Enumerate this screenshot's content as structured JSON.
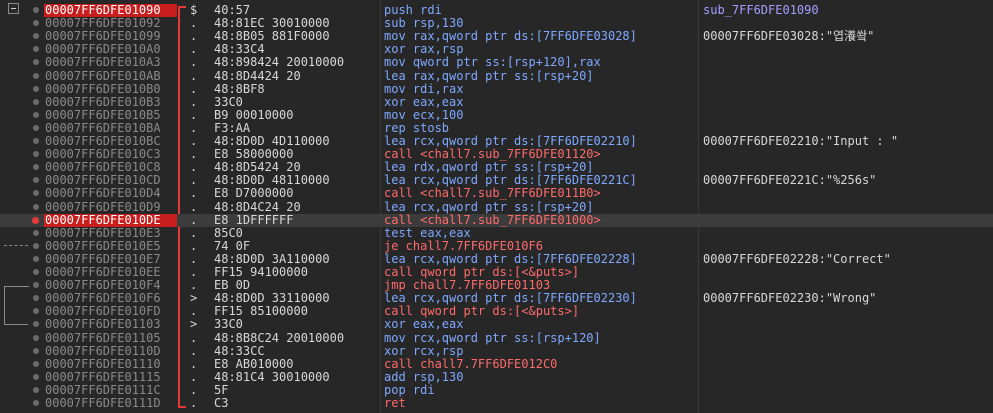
{
  "rows": [
    {
      "addr": "00007FF6DFE01090",
      "mark": "$",
      "bytes": "40:57",
      "instr": "push rdi",
      "comment": "sub_7FF6DFE01090",
      "kind": "",
      "comment_kind": "label",
      "bp": false,
      "current": true
    },
    {
      "addr": "00007FF6DFE01092",
      "mark": ".",
      "bytes": "48:81EC 30010000",
      "instr": "sub rsp,130",
      "comment": "",
      "kind": "",
      "bp": false
    },
    {
      "addr": "00007FF6DFE01099",
      "mark": ".",
      "bytes": "48:8B05 881F0000",
      "instr": "mov rax,qword ptr ds:[7FF6DFE03028]",
      "comment": "00007FF6DFE03028:\"엽瀁쐌\"",
      "kind": "",
      "bp": false
    },
    {
      "addr": "00007FF6DFE010A0",
      "mark": ".",
      "bytes": "48:33C4",
      "instr": "xor rax,rsp",
      "comment": "",
      "kind": "",
      "bp": false
    },
    {
      "addr": "00007FF6DFE010A3",
      "mark": ".",
      "bytes": "48:898424 20010000",
      "instr": "mov qword ptr ss:[rsp+120],rax",
      "comment": "",
      "kind": "",
      "bp": false
    },
    {
      "addr": "00007FF6DFE010AB",
      "mark": ".",
      "bytes": "48:8D4424 20",
      "instr": "lea rax,qword ptr ss:[rsp+20]",
      "comment": "",
      "kind": "",
      "bp": false
    },
    {
      "addr": "00007FF6DFE010B0",
      "mark": ".",
      "bytes": "48:8BF8",
      "instr": "mov rdi,rax",
      "comment": "",
      "kind": "",
      "bp": false
    },
    {
      "addr": "00007FF6DFE010B3",
      "mark": ".",
      "bytes": "33C0",
      "instr": "xor eax,eax",
      "comment": "",
      "kind": "",
      "bp": false
    },
    {
      "addr": "00007FF6DFE010B5",
      "mark": ".",
      "bytes": "B9 00010000",
      "instr": "mov ecx,100",
      "comment": "",
      "kind": "",
      "bp": false
    },
    {
      "addr": "00007FF6DFE010BA",
      "mark": ".",
      "bytes": "F3:AA",
      "instr": "rep stosb",
      "comment": "",
      "kind": "",
      "bp": false
    },
    {
      "addr": "00007FF6DFE010BC",
      "mark": ".",
      "bytes": "48:8D0D 4D110000",
      "instr": "lea rcx,qword ptr ds:[7FF6DFE02210]",
      "comment": "00007FF6DFE02210:\"Input : \"",
      "kind": "",
      "bp": false
    },
    {
      "addr": "00007FF6DFE010C3",
      "mark": ".",
      "bytes": "E8 58000000",
      "instr": "call <chall7.sub_7FF6DFE01120>",
      "comment": "",
      "kind": "call",
      "bp": false
    },
    {
      "addr": "00007FF6DFE010C8",
      "mark": ".",
      "bytes": "48:8D5424 20",
      "instr": "lea rdx,qword ptr ss:[rsp+20]",
      "comment": "",
      "kind": "",
      "bp": false
    },
    {
      "addr": "00007FF6DFE010CD",
      "mark": ".",
      "bytes": "48:8D0D 48110000",
      "instr": "lea rcx,qword ptr ds:[7FF6DFE0221C]",
      "comment": "00007FF6DFE0221C:\"%256s\"",
      "kind": "",
      "bp": false
    },
    {
      "addr": "00007FF6DFE010D4",
      "mark": ".",
      "bytes": "E8 D7000000",
      "instr": "call <chall7.sub_7FF6DFE011B0>",
      "comment": "",
      "kind": "call",
      "bp": false
    },
    {
      "addr": "00007FF6DFE010D9",
      "mark": ".",
      "bytes": "48:8D4C24 20",
      "instr": "lea rcx,qword ptr ss:[rsp+20]",
      "comment": "",
      "kind": "",
      "bp": false
    },
    {
      "addr": "00007FF6DFE010DE",
      "mark": ".",
      "bytes": "E8 1DFFFFFF",
      "instr": "call <chall7.sub_7FF6DFE01000>",
      "comment": "",
      "kind": "call",
      "bp": true,
      "selected": true
    },
    {
      "addr": "00007FF6DFE010E3",
      "mark": ".",
      "bytes": "85C0",
      "instr": "test eax,eax",
      "comment": "",
      "kind": "",
      "bp": false
    },
    {
      "addr": "00007FF6DFE010E5",
      "mark": ".",
      "bytes": "74 0F",
      "instr": "je chall7.7FF6DFE010F6",
      "comment": "",
      "kind": "jmp",
      "bp": false
    },
    {
      "addr": "00007FF6DFE010E7",
      "mark": ".",
      "bytes": "48:8D0D 3A110000",
      "instr": "lea rcx,qword ptr ds:[7FF6DFE02228]",
      "comment": "00007FF6DFE02228:\"Correct\"",
      "kind": "",
      "bp": false
    },
    {
      "addr": "00007FF6DFE010EE",
      "mark": ".",
      "bytes": "FF15 94100000",
      "instr": "call qword ptr ds:[<&puts>]",
      "comment": "",
      "kind": "call",
      "bp": false
    },
    {
      "addr": "00007FF6DFE010F4",
      "mark": ".",
      "bytes": "EB 0D",
      "instr": "jmp chall7.7FF6DFE01103",
      "comment": "",
      "kind": "jmp",
      "bp": false
    },
    {
      "addr": "00007FF6DFE010F6",
      "mark": ">",
      "bytes": "48:8D0D 33110000",
      "instr": "lea rcx,qword ptr ds:[7FF6DFE02230]",
      "comment": "00007FF6DFE02230:\"Wrong\"",
      "kind": "",
      "bp": false
    },
    {
      "addr": "00007FF6DFE010FD",
      "mark": ".",
      "bytes": "FF15 85100000",
      "instr": "call qword ptr ds:[<&puts>]",
      "comment": "",
      "kind": "call",
      "bp": false
    },
    {
      "addr": "00007FF6DFE01103",
      "mark": ">",
      "bytes": "33C0",
      "instr": "xor eax,eax",
      "comment": "",
      "kind": "",
      "bp": false
    },
    {
      "addr": "00007FF6DFE01105",
      "mark": ".",
      "bytes": "48:8B8C24 20010000",
      "instr": "mov rcx,qword ptr ss:[rsp+120]",
      "comment": "",
      "kind": "",
      "bp": false
    },
    {
      "addr": "00007FF6DFE0110D",
      "mark": ".",
      "bytes": "48:33CC",
      "instr": "xor rcx,rsp",
      "comment": "",
      "kind": "",
      "bp": false
    },
    {
      "addr": "00007FF6DFE01110",
      "mark": ".",
      "bytes": "E8 AB010000",
      "instr": "call chall7.7FF6DFE012C0",
      "comment": "",
      "kind": "call",
      "bp": false
    },
    {
      "addr": "00007FF6DFE01115",
      "mark": ".",
      "bytes": "48:81C4 30010000",
      "instr": "add rsp,130",
      "comment": "",
      "kind": "",
      "bp": false
    },
    {
      "addr": "00007FF6DFE0111C",
      "mark": ".",
      "bytes": "5F",
      "instr": "pop rdi",
      "comment": "",
      "kind": "",
      "bp": false
    },
    {
      "addr": "00007FF6DFE0111D",
      "mark": ".",
      "bytes": "C3",
      "instr": "ret",
      "comment": "",
      "kind": "call",
      "bp": false
    }
  ],
  "colors": {
    "background": "#272727",
    "breakpoint": "#e53a3a",
    "current_addr_bg": "#c81e1e",
    "instr": "#7fa8ff",
    "call": "#ff6b6b",
    "label": "#a99cff"
  }
}
